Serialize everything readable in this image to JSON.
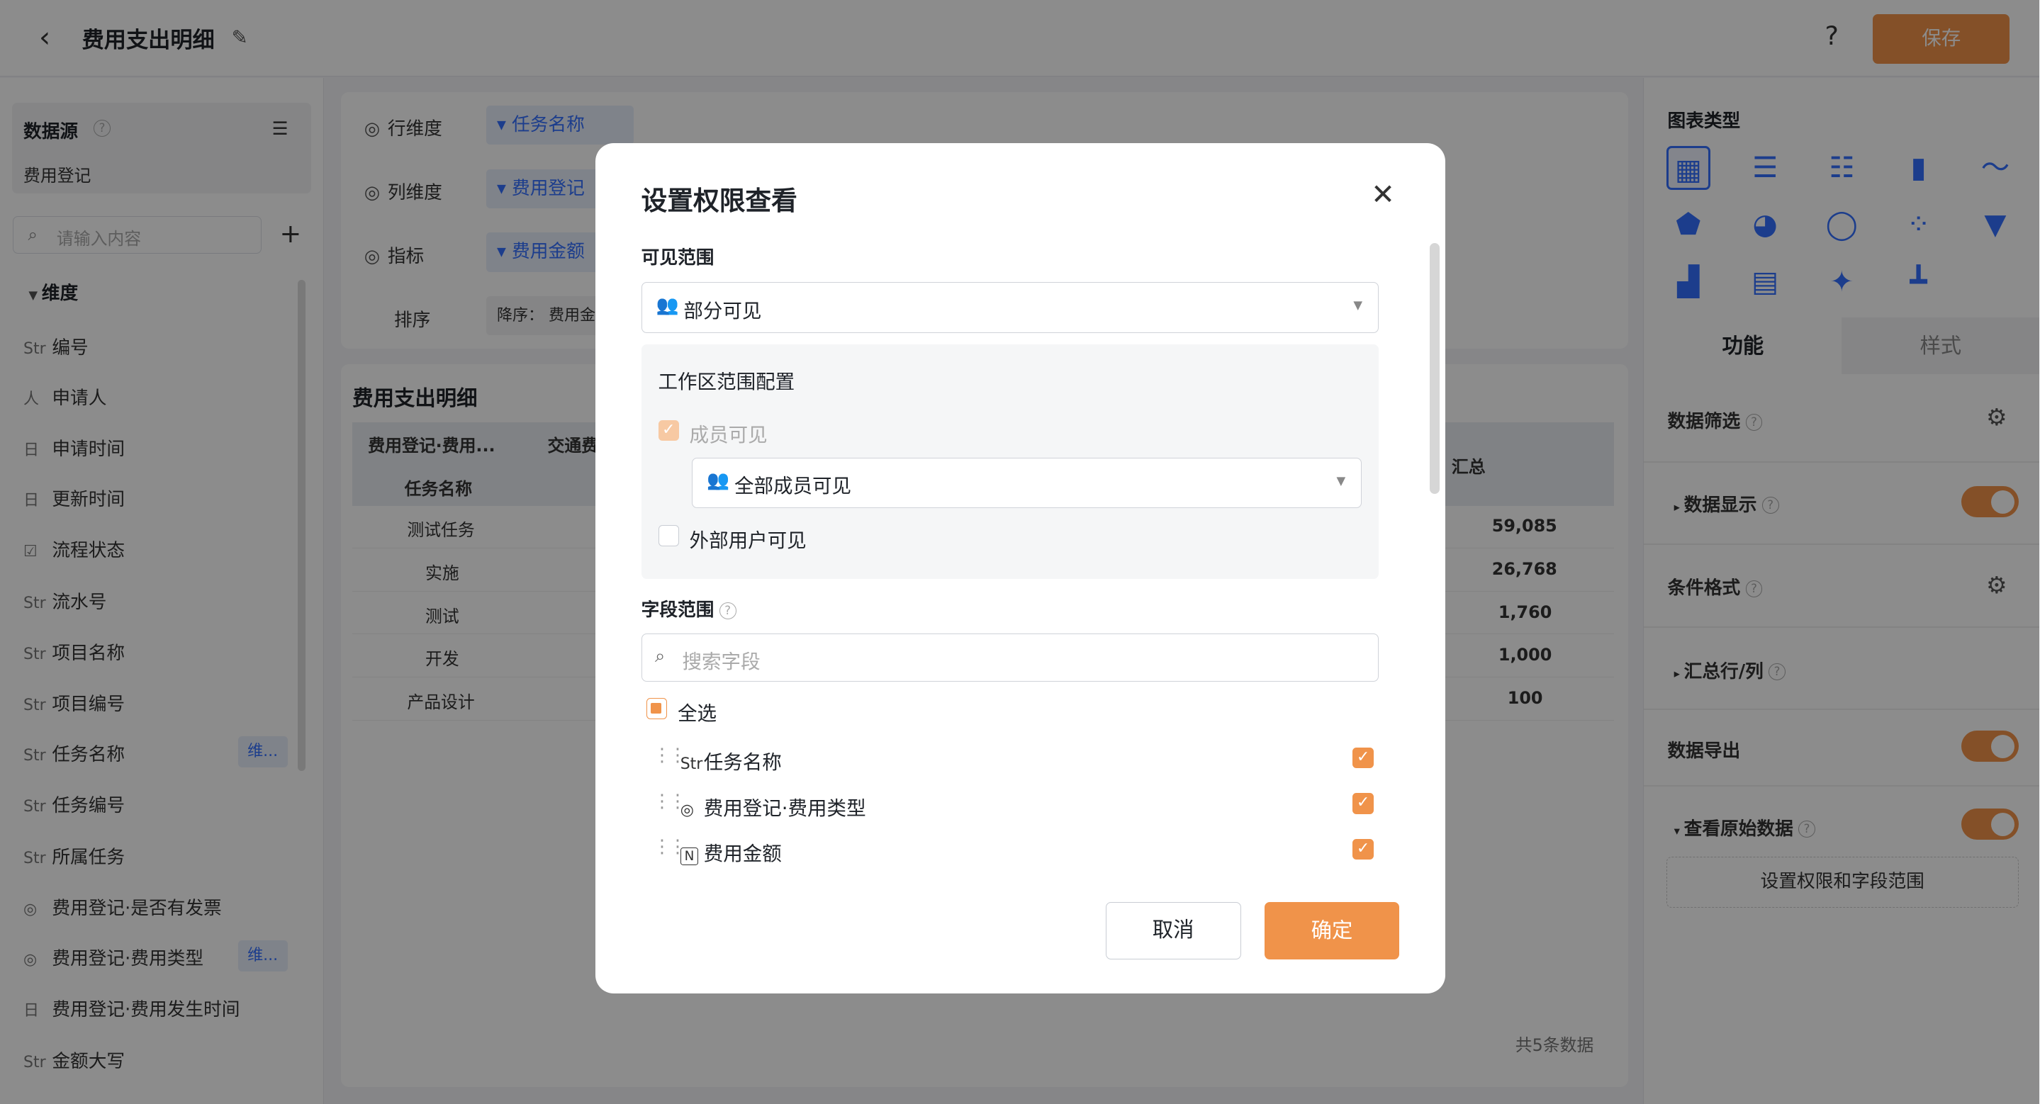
{
  "header": {
    "title": "费用支出明细",
    "help": "?",
    "save_label": "保存"
  },
  "left_panel": {
    "datasource_title": "数据源",
    "datasource_name": "费用登记",
    "search_placeholder": "请输入内容",
    "dimension_title": "维度",
    "fields": [
      {
        "prefix": "Str",
        "label": "编号"
      },
      {
        "prefix": "人",
        "label": "申请人"
      },
      {
        "prefix": "日",
        "label": "申请时间"
      },
      {
        "prefix": "日",
        "label": "更新时间"
      },
      {
        "prefix": "☑",
        "label": "流程状态"
      },
      {
        "prefix": "Str",
        "label": "流水号"
      },
      {
        "prefix": "Str",
        "label": "项目名称"
      },
      {
        "prefix": "Str",
        "label": "项目编号"
      },
      {
        "prefix": "Str",
        "label": "任务名称",
        "tag": "维..."
      },
      {
        "prefix": "Str",
        "label": "任务编号"
      },
      {
        "prefix": "Str",
        "label": "所属任务"
      },
      {
        "prefix": "◎",
        "label": "费用登记·是否有发票"
      },
      {
        "prefix": "◎",
        "label": "费用登记·费用类型",
        "tag": "维..."
      },
      {
        "prefix": "日",
        "label": "费用登记·费用发生时间"
      },
      {
        "prefix": "Str",
        "label": "金额大写"
      }
    ]
  },
  "config": {
    "row_label": "行维度",
    "row_value": "任务名称",
    "col_label": "列维度",
    "col_value": "费用登记",
    "metric_label": "指标",
    "metric_value": "费用金额",
    "sort_label": "排序",
    "sort_value": "降序： 费用金"
  },
  "table": {
    "title": "费用支出明细",
    "header_top": [
      "费用登记·费用...",
      "交通费",
      "汇总"
    ],
    "header_sub": "任务名称",
    "rows": [
      {
        "name": "测试任务",
        "total": "59,085"
      },
      {
        "name": "实施",
        "total": "26,768"
      },
      {
        "name": "测试",
        "total": "1,760"
      },
      {
        "name": "开发",
        "total": "1,000"
      },
      {
        "name": "产品设计",
        "total": "100"
      }
    ],
    "count": "共5条数据"
  },
  "right_panel": {
    "chart_type_title": "图表类型",
    "tab_function": "功能",
    "tab_style": "样式",
    "data_filter": "数据筛选",
    "data_display": "数据显示",
    "cond_format": "条件格式",
    "summary": "汇总行/列",
    "data_export": "数据导出",
    "view_raw": "查看原始数据",
    "perm_button": "设置权限和字段范围"
  },
  "modal": {
    "title": "设置权限查看",
    "visible_range_label": "可见范围",
    "visible_range_value": "部分可见",
    "workspace_title": "工作区范围配置",
    "member_visible": "成员可见",
    "member_scope_value": "全部成员可见",
    "external_visible": "外部用户可见",
    "field_range_label": "字段范围",
    "search_placeholder": "搜索字段",
    "select_all": "全选",
    "fields": [
      {
        "prefix": "Str",
        "label": "任务名称"
      },
      {
        "prefix": "◎",
        "label": "费用登记·费用类型"
      },
      {
        "prefix": "N",
        "label": "费用金额"
      }
    ],
    "cancel": "取消",
    "ok": "确定"
  }
}
